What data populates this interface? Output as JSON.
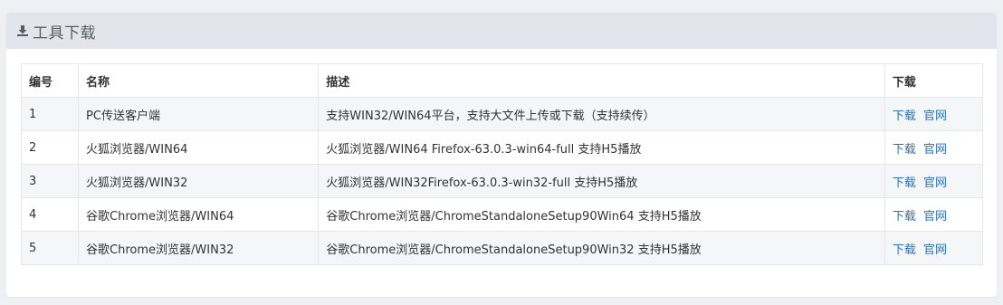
{
  "panel": {
    "title": "工具下载",
    "icon": "download-icon"
  },
  "table": {
    "headers": {
      "no": "编号",
      "name": "名称",
      "desc": "描述",
      "download": "下载"
    },
    "rows": [
      {
        "no": "1",
        "name": "PC传送客户端",
        "desc": "支持WIN32/WIN64平台，支持大文件上传或下载（支持续传）",
        "download_label": "下载",
        "official_label": "官网"
      },
      {
        "no": "2",
        "name": "火狐浏览器/WIN64",
        "desc": "火狐浏览器/WIN64 Firefox-63.0.3-win64-full 支持H5播放",
        "download_label": "下载",
        "official_label": "官网"
      },
      {
        "no": "3",
        "name": "火狐浏览器/WIN32",
        "desc": "火狐浏览器/WIN32Firefox-63.0.3-win32-full 支持H5播放",
        "download_label": "下载",
        "official_label": "官网"
      },
      {
        "no": "4",
        "name": "谷歌Chrome浏览器/WIN64",
        "desc": "谷歌Chrome浏览器/ChromeStandaloneSetup90Win64 支持H5播放",
        "download_label": "下载",
        "official_label": "官网"
      },
      {
        "no": "5",
        "name": "谷歌Chrome浏览器/WIN32",
        "desc": "谷歌Chrome浏览器/ChromeStandaloneSetup90Win32 支持H5播放",
        "download_label": "下载",
        "official_label": "官网"
      }
    ]
  },
  "colors": {
    "link": "#2a72b5",
    "header_bg": "#e2e6ec",
    "page_bg": "#eef0f3"
  }
}
